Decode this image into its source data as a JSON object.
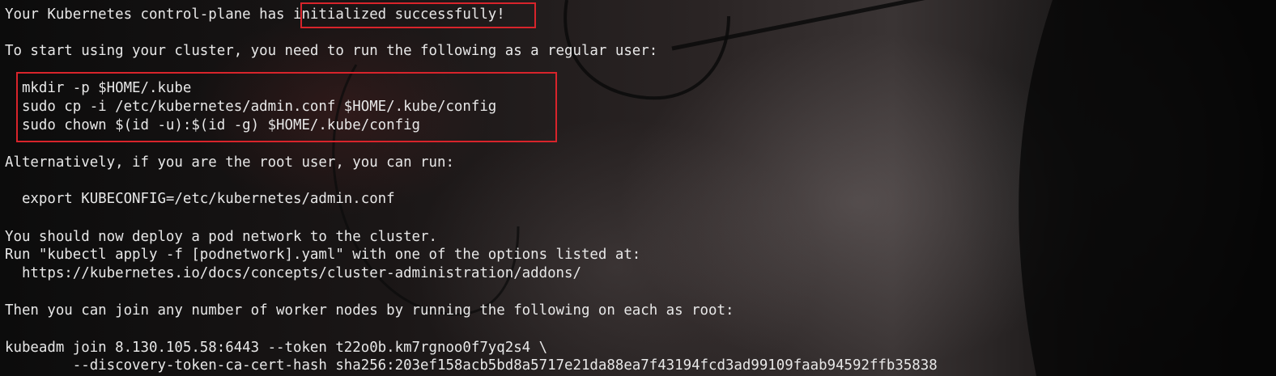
{
  "output": {
    "l1_prefix": "Your Kubernetes control-plane has ",
    "l1_success": "initialized successfully!",
    "l2": "To start using your cluster, you need to run the following as a regular user:",
    "cmd1": "  mkdir -p $HOME/.kube",
    "cmd2": "  sudo cp -i /etc/kubernetes/admin.conf $HOME/.kube/config",
    "cmd3": "  sudo chown $(id -u):$(id -g) $HOME/.kube/config",
    "l6": "Alternatively, if you are the root user, you can run:",
    "l7": "  export KUBECONFIG=/etc/kubernetes/admin.conf",
    "l8": "You should now deploy a pod network to the cluster.",
    "l9": "Run \"kubectl apply -f [podnetwork].yaml\" with one of the options listed at:",
    "l10": "  https://kubernetes.io/docs/concepts/cluster-administration/addons/",
    "l11": "Then you can join any number of worker nodes by running the following on each as root:",
    "l12": "kubeadm join 8.130.105.58:6443 --token t22o0b.km7rgnoo0f7yq2s4 \\",
    "l13": "        --discovery-token-ca-cert-hash sha256:203ef158acb5bd8a5717e21da88ea7f43194fcd3ad99109faab94592ffb35838"
  },
  "highlight_color": "#d8242b",
  "text_color": "#e8e8e8"
}
